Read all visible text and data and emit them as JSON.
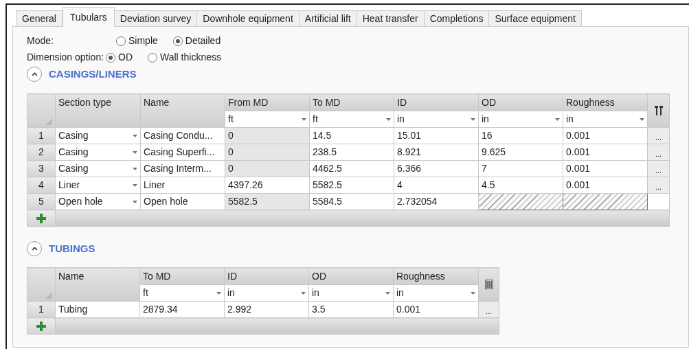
{
  "tabs": [
    {
      "label": "General",
      "selected": false
    },
    {
      "label": "Tubulars",
      "selected": true
    },
    {
      "label": "Deviation survey",
      "selected": false
    },
    {
      "label": "Downhole equipment",
      "selected": false
    },
    {
      "label": "Artificial lift",
      "selected": false
    },
    {
      "label": "Heat transfer",
      "selected": false
    },
    {
      "label": "Completions",
      "selected": false
    },
    {
      "label": "Surface equipment",
      "selected": false
    }
  ],
  "options": [
    {
      "label": "Mode:",
      "choices": [
        {
          "label": "Simple",
          "selected": false
        },
        {
          "label": "Detailed",
          "selected": true
        }
      ]
    },
    {
      "label": "Dimension option:",
      "choices": [
        {
          "label": "OD",
          "selected": true
        },
        {
          "label": "Wall thickness",
          "selected": false
        }
      ]
    }
  ],
  "sections": [
    {
      "title": "CASINGS/LINERS",
      "expanded": true,
      "columns": [
        {
          "title": "Section type",
          "dropdown": true
        },
        {
          "title": "Name"
        },
        {
          "title": "From MD",
          "unit": "ft"
        },
        {
          "title": "To MD",
          "unit": "ft"
        },
        {
          "title": "ID",
          "unit": "in"
        },
        {
          "title": "OD",
          "unit": "in"
        },
        {
          "title": "Roughness",
          "unit": "in"
        }
      ],
      "rows": [
        {
          "number": "1",
          "button": "...",
          "cells": [
            {
              "value": "Casing"
            },
            {
              "value": "Casing Condu..."
            },
            {
              "value": "0",
              "shaded": true
            },
            {
              "value": "14.5"
            },
            {
              "value": "15.01"
            },
            {
              "value": "16"
            },
            {
              "value": "0.001"
            }
          ]
        },
        {
          "number": "2",
          "button": "...",
          "cells": [
            {
              "value": "Casing"
            },
            {
              "value": "Casing Superfi..."
            },
            {
              "value": "0",
              "shaded": true
            },
            {
              "value": "238.5"
            },
            {
              "value": "8.921"
            },
            {
              "value": "9.625"
            },
            {
              "value": "0.001"
            }
          ]
        },
        {
          "number": "3",
          "button": "...",
          "cells": [
            {
              "value": "Casing"
            },
            {
              "value": "Casing Interm..."
            },
            {
              "value": "0",
              "shaded": true
            },
            {
              "value": "4462.5"
            },
            {
              "value": "6.366"
            },
            {
              "value": "7"
            },
            {
              "value": "0.001"
            }
          ]
        },
        {
          "number": "4",
          "button": "...",
          "cells": [
            {
              "value": "Liner"
            },
            {
              "value": "Liner"
            },
            {
              "value": "4397.26"
            },
            {
              "value": "5582.5"
            },
            {
              "value": "4"
            },
            {
              "value": "4.5"
            },
            {
              "value": "0.001"
            }
          ]
        },
        {
          "number": "5",
          "cells": [
            {
              "value": "Open hole"
            },
            {
              "value": "Open hole"
            },
            {
              "value": "5582.5",
              "shaded": true
            },
            {
              "value": "5584.5"
            },
            {
              "value": "2.732054"
            },
            {
              "kind": "hatched"
            },
            {
              "kind": "hatched"
            }
          ]
        }
      ]
    },
    {
      "title": "TUBINGS",
      "expanded": true,
      "columns": [
        {
          "title": "Name"
        },
        {
          "title": "To MD",
          "unit": "ft"
        },
        {
          "title": "ID",
          "unit": "in"
        },
        {
          "title": "OD",
          "unit": "in"
        },
        {
          "title": "Roughness",
          "unit": "in"
        }
      ],
      "rows": [
        {
          "number": "1",
          "button": "...",
          "cells": [
            {
              "value": "Tubing"
            },
            {
              "value": "2879.34"
            },
            {
              "value": "2.992"
            },
            {
              "value": "3.5"
            },
            {
              "value": "0.001"
            }
          ]
        }
      ]
    }
  ]
}
